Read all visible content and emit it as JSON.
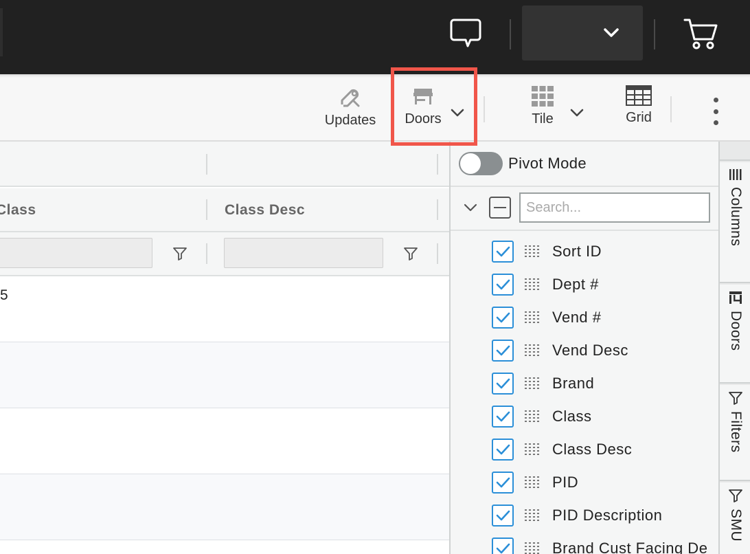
{
  "header": {
    "chat_icon": "speech-bubble-icon",
    "account_dropdown_icon": "chevron-down-icon",
    "account_label": "",
    "cart_icon": "shopping-cart-icon"
  },
  "toolbar": {
    "updates_label": "Updates",
    "doors_label": "Doors",
    "tile_label": "Tile",
    "grid_label": "Grid",
    "highlight_color": "#f0564a"
  },
  "grid": {
    "columns": [
      {
        "header": "Class",
        "filter_value": ""
      },
      {
        "header": "Class Desc",
        "filter_value": ""
      }
    ],
    "rows": [
      {
        "class": "5",
        "class_desc": ""
      },
      {
        "class": "",
        "class_desc": ""
      },
      {
        "class": "",
        "class_desc": ""
      },
      {
        "class": "",
        "class_desc": ""
      }
    ]
  },
  "columns_panel": {
    "pivot_mode_label": "Pivot Mode",
    "pivot_mode_on": false,
    "search_placeholder": "Search...",
    "items": [
      {
        "label": "Sort ID",
        "checked": true
      },
      {
        "label": "Dept #",
        "checked": true
      },
      {
        "label": "Vend #",
        "checked": true
      },
      {
        "label": "Vend Desc",
        "checked": true
      },
      {
        "label": "Brand",
        "checked": true
      },
      {
        "label": "Class",
        "checked": true
      },
      {
        "label": "Class Desc",
        "checked": true
      },
      {
        "label": "PID",
        "checked": true
      },
      {
        "label": "PID Description",
        "checked": true
      },
      {
        "label": "Brand Cust Facing De",
        "checked": true
      }
    ],
    "checkbox_color": "#2b8fd8"
  },
  "side_tabs": [
    {
      "label": "Columns",
      "icon": "columns-icon"
    },
    {
      "label": "Doors",
      "icon": "store-icon"
    },
    {
      "label": "Filters",
      "icon": "filter-icon"
    },
    {
      "label": "SMU",
      "icon": "filter-icon"
    }
  ]
}
